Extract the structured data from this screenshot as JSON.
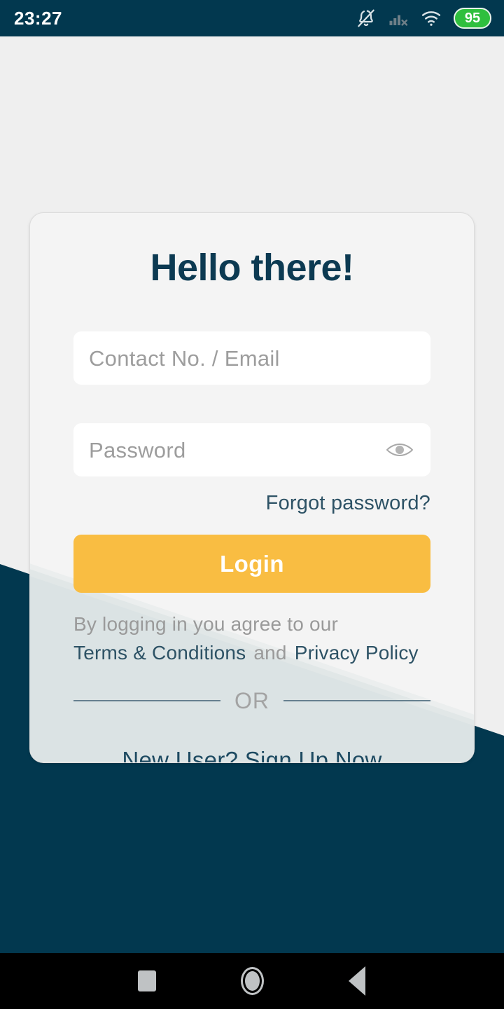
{
  "status_bar": {
    "time": "23:27",
    "battery_level": "95",
    "icons": [
      "bell-muted-icon",
      "signal-no-service-icon",
      "wifi-icon",
      "battery-badge"
    ],
    "background_color": "#02384f",
    "battery_color": "#2fbf3e"
  },
  "card": {
    "title": "Hello there!",
    "contact_placeholder": "Contact No. / Email",
    "contact_value": "",
    "password_placeholder": "Password",
    "password_value": "",
    "password_toggle_icon": "eye-icon",
    "forgot_label": "Forgot password?",
    "login_label": "Login",
    "agree_text": "By logging in you agree to our",
    "terms_label": "Terms & Conditions",
    "and_label": "and",
    "privacy_label": "Privacy Policy",
    "or_label": "OR",
    "signup_label": "New User? Sign Up Now"
  },
  "navigation_bar": {
    "recents_label": "recents-square-icon",
    "home_label": "home-circle-icon",
    "back_label": "back-triangle-icon"
  },
  "colors": {
    "navy": "#02384f",
    "accent_yellow": "#f9bd42",
    "page_background": "#efefef",
    "card_background": "#f4f4f4",
    "link_teal": "#2d5265",
    "placeholder_gray": "#9d9d9d"
  }
}
